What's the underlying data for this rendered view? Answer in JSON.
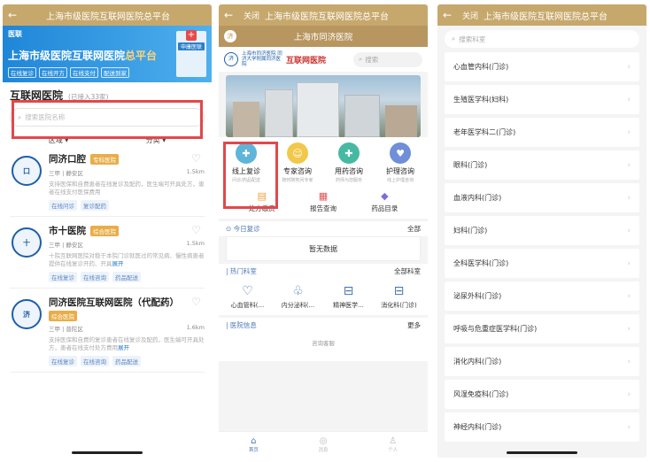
{
  "panel1": {
    "topbar_title": "上海市级医院互联网医院总平台",
    "banner": {
      "logo": "医联",
      "title_main": "上海市级医院互联网医院",
      "title_highlight": "总平台",
      "tags": [
        "在线复诊",
        "在线开方",
        "在线支付",
        "配送到家"
      ],
      "building_sign": "申康医联"
    },
    "section_title": "互联网医院",
    "section_count": "(已接入33家)",
    "search_placeholder": "搜索医院名称",
    "filters": [
      "区域",
      "分类"
    ],
    "hospitals": [
      {
        "name": "同济口腔",
        "badge": "专科医院",
        "level": "三甲 | 静安区",
        "distance": "1.5km",
        "desc": "支持医保和自费患者在线复诊及配药，医生端可开具处方，患者在线支付医保费用",
        "more": "",
        "chips": [
          "在线问诊",
          "复诊配药"
        ],
        "emblem": "口"
      },
      {
        "name": "市十医院",
        "badge": "综合医院",
        "level": "三甲 | 静安区",
        "distance": "1.5km",
        "desc": "十院互联网医院对稳于本院门诊就医过的常见病、慢性病患者提供在线复诊开药、开具",
        "more": "展开",
        "chips": [
          "在线复诊",
          "在线咨询",
          "药品配送"
        ],
        "emblem": "十"
      },
      {
        "name": "同济医院互联网医院（代配药）",
        "badge": "综合医院",
        "level": "三甲 | 普陀区",
        "distance": "1.6km",
        "desc": "支持医保和自费的复诊患者在线复诊及配药，医生端可开具处方，患者在线支付处方费用",
        "more": "展开",
        "chips": [
          "在线复诊",
          "在线咨询",
          "药品配送"
        ],
        "emblem": "济"
      }
    ]
  },
  "panel2": {
    "topbar_close": "关闭",
    "topbar_title": "上海市级医院互联网医院总平台",
    "hospital_title": "上海市同济医院",
    "avatar": "济",
    "brand_cn": "上海市同济医院 同济大学附属同济医院",
    "brand_ih": "互联网医院",
    "search": "搜索",
    "services": [
      {
        "label": "线上复诊",
        "sub": "问诊/药品配送",
        "color": "#5fb5d9",
        "icon": "✚"
      },
      {
        "label": "专家咨询",
        "sub": "随时随地问专家",
        "color": "#f2c84b",
        "icon": "☺"
      },
      {
        "label": "用药咨询",
        "sub": "药师为您服务",
        "color": "#46b9a3",
        "icon": "✚"
      },
      {
        "label": "护理咨询",
        "sub": "线上护理咨询",
        "color": "#6f8fd8",
        "icon": "♥"
      }
    ],
    "services2": [
      {
        "label": "处方缴费",
        "icon": "▤",
        "color": "#f0a03a"
      },
      {
        "label": "报告查询",
        "icon": "▦",
        "color": "#e05454"
      },
      {
        "label": "药品目录",
        "icon": "◆",
        "color": "#7a6fd8"
      }
    ],
    "today_label": "今日复诊",
    "today_all": "全部",
    "nodata": "暂无数据",
    "hot_label": "热门科室",
    "hot_all": "全部科室",
    "depts": [
      "心血管科(...",
      "内分泌科(...",
      "精神医学...",
      "消化科(门诊)"
    ],
    "info_label": "医院信息",
    "info_more": "更多",
    "consult": "咨询客服",
    "tabs": [
      {
        "label": "首页",
        "icon": "⌂",
        "active": true
      },
      {
        "label": "消息",
        "icon": "◎",
        "active": false
      },
      {
        "label": "个人",
        "icon": "♙",
        "active": false
      }
    ]
  },
  "panel3": {
    "topbar_close": "关闭",
    "topbar_title": "上海市级医院互联网医院总平台",
    "search_placeholder": "搜索科室",
    "departments": [
      "心血管内科(门诊)",
      "生殖医学科(妇科)",
      "老年医学科二(门诊)",
      "眼科(门诊)",
      "血液内科(门诊)",
      "妇科(门诊)",
      "全科医学科(门诊)",
      "泌尿外科(门诊)",
      "呼吸与危重症医学科(门诊)",
      "消化内科(门诊)",
      "风湿免疫科(门诊)",
      "神经内科(门诊)"
    ]
  }
}
